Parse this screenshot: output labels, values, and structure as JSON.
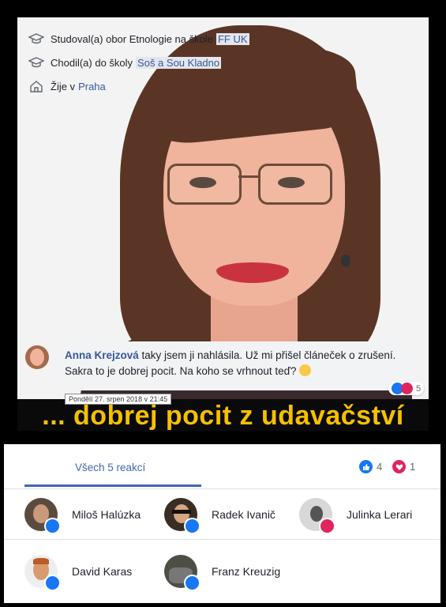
{
  "profile": {
    "studied": {
      "text": "Studoval(a) obor Etnologie na škole",
      "link": "FF UK"
    },
    "school": {
      "text": "Chodil(a) do školy",
      "link": "Soš a Sou Kladno"
    },
    "lives": {
      "text": "Žije v",
      "link": "Praha"
    }
  },
  "comment": {
    "author": "Anna Krejzová",
    "text": " taky jsem ji nahlásila. Už mi přišel článeček o zrušení. Sakra to je dobrej pocit. Na koho se vrhnout teď? ",
    "reaction_count": "5",
    "timestamp": "Pondělí 27. srpen 2018 v 21:45"
  },
  "caption": "... dobrej pocit z udavačství",
  "reactions": {
    "tab_all_label": "Všech 5 reakcí",
    "like_count": "4",
    "love_count": "1",
    "people": [
      {
        "name": "Miloš Halúzka",
        "reaction": "like"
      },
      {
        "name": "Radek Ivanič",
        "reaction": "like"
      },
      {
        "name": "Julinka Lerari",
        "reaction": "love"
      },
      {
        "name": "David Karas",
        "reaction": "like"
      },
      {
        "name": "Franz Kreuzig",
        "reaction": "like"
      }
    ]
  },
  "colors": {
    "link": "#365899",
    "like": "#1877f2",
    "love": "#e0245e",
    "caption": "#f5c000"
  }
}
